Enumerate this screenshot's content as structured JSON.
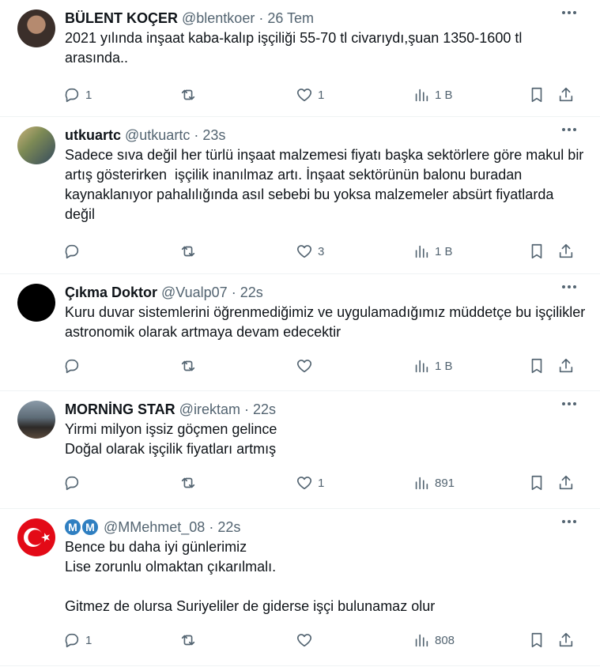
{
  "tweets": [
    {
      "name": "BÜLENT KOÇER",
      "handle": "@blentkoer",
      "time": "26 Tem",
      "text": "2021 yılında inşaat kaba-kalıp işçiliği 55-70 tl civarıydı,şuan 1350-1600 tl arasında..",
      "replies": "1",
      "retweets": "",
      "likes": "1",
      "views": "1 B",
      "avatar_color": "#5a4a40"
    },
    {
      "name": "utkuartc",
      "handle": "@utkuartc",
      "time": "23s",
      "text": "Sadece sıva değil her türlü inşaat malzemesi fiyatı başka sektörlere göre makul bir artış gösterirken  işçilik inanılmaz artı. İnşaat sektörünün balonu buradan kaynaklanıyor pahalılığında asıl sebebi bu yoksa malzemeler absürt fiyatlarda değil",
      "replies": "",
      "retweets": "",
      "likes": "3",
      "views": "1 B",
      "avatar_color": "#7a7a6a"
    },
    {
      "name": "Çıkma Doktor",
      "handle": "@Vualp07",
      "time": "22s",
      "text": "Kuru duvar sistemlerini öğrenmediğimiz ve uygulamadığımız müddetçe bu işçilikler astronomik olarak artmaya devam edecektir",
      "replies": "",
      "retweets": "",
      "likes": "",
      "views": "1 B",
      "avatar_color": "#000000"
    },
    {
      "name": "MORNİNG STAR",
      "handle": "@irektam",
      "time": "22s",
      "text": "Yirmi milyon işsiz göçmen gelince\nDoğal olarak işçilik fiyatları artmış",
      "replies": "",
      "retweets": "",
      "likes": "1",
      "views": "891",
      "avatar_color": "#4a5a6a"
    },
    {
      "name": "",
      "name_badge": "M",
      "handle": "@MMehmet_08",
      "time": "22s",
      "text": "Bence bu daha iyi günlerimiz\nLise zorunlu olmaktan çıkarılmalı.\n\nGitmez de olursa Suriyeliler de giderse işçi bulunamaz olur",
      "replies": "1",
      "retweets": "",
      "likes": "",
      "views": "808",
      "avatar_color": "#e30a17"
    }
  ]
}
